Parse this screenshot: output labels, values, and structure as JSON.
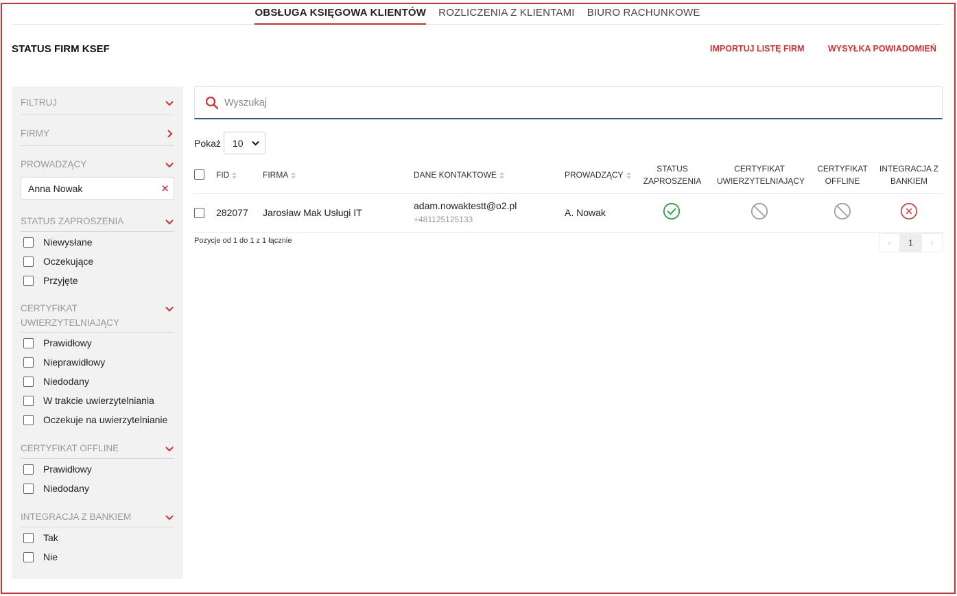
{
  "nav": {
    "tabs": [
      {
        "label": "OBSŁUGA KSIĘGOWA KLIENTÓW",
        "active": true
      },
      {
        "label": "ROZLICZENIA Z KLIENTAMI",
        "active": false
      },
      {
        "label": "BIURO RACHUNKOWE",
        "active": false
      }
    ]
  },
  "header": {
    "title": "STATUS FIRM KSEF",
    "import_link": "IMPORTUJ LISTĘ FIRM",
    "notify_link": "WYSYŁKA POWIADOMIEŃ"
  },
  "sidebar": {
    "filter_label": "FILTRUJ",
    "firms_label": "FIRMY",
    "owner_label": "PROWADZĄCY",
    "owner_value": "Anna Nowak",
    "invite_label": "STATUS ZAPROSZENIA",
    "invite_options": [
      "Niewysłane",
      "Oczekujące",
      "Przyjęte"
    ],
    "cert_label": "CERTYFIKAT UWIERZYTELNIAJĄCY",
    "cert_options": [
      "Prawidłowy",
      "Nieprawidłowy",
      "Niedodany",
      "W trakcie uwierzytelniania",
      "Oczekuje na uwierzytelnianie"
    ],
    "offline_label": "CERTYFIKAT OFFLINE",
    "offline_options": [
      "Prawidłowy",
      "Niedodany"
    ],
    "bank_label": "INTEGRACJA Z BANKIEM",
    "bank_options": [
      "Tak",
      "Nie"
    ]
  },
  "search": {
    "placeholder": "Wyszukaj"
  },
  "show": {
    "label": "Pokaż",
    "value": "10"
  },
  "table": {
    "headers": {
      "fid": "FID",
      "firm": "FIRMA",
      "contact": "DANE KONTAKTOWE",
      "owner": "PROWADZĄCY",
      "invite": "STATUS ZAPROSZENIA",
      "cert": "CERTYFIKAT UWIERZYTELNIAJĄCY",
      "offline": "CERTYFIKAT OFFLINE",
      "bank": "INTEGRACJA Z BANKIEM"
    },
    "rows": [
      {
        "fid": "282077",
        "firm": "Jarosław Mak Usługi IT",
        "email": "adam.nowaktestt@o2.pl",
        "phone": "+481125125133",
        "owner": "A. Nowak",
        "invite_status": "check-circle-icon",
        "cert_status": "ban-icon",
        "offline_status": "ban-icon",
        "bank_status": "x-circle-icon"
      }
    ]
  },
  "footer": {
    "info": "Pozycje od 1 do 1 z 1 łącznie",
    "page": "1"
  },
  "colors": {
    "accent": "#d32f2f",
    "success": "#2e9e3e",
    "muted": "#9e9e9e",
    "search_underline": "#2c5d7a"
  }
}
